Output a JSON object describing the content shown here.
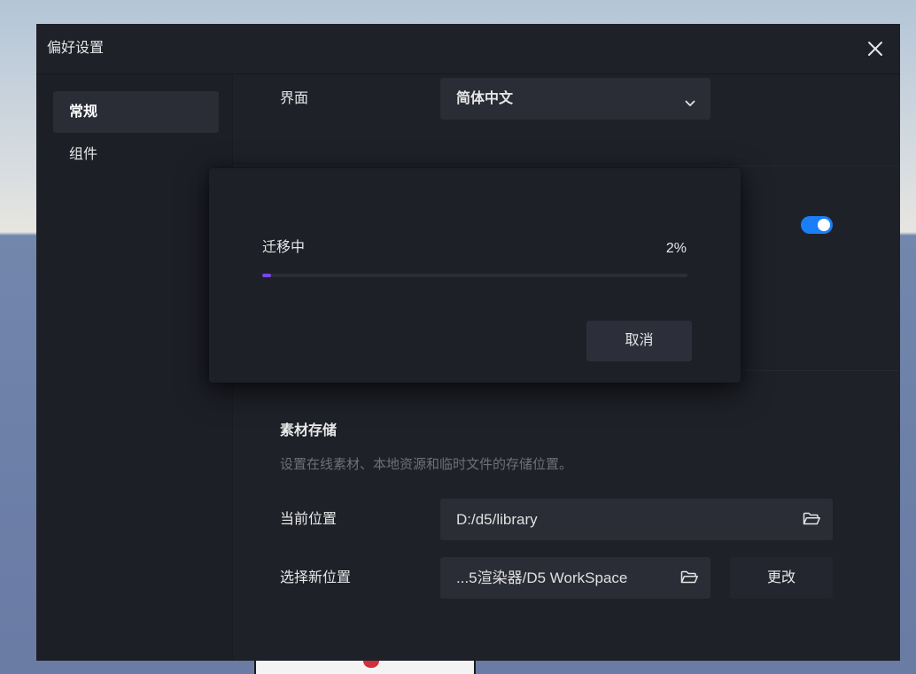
{
  "window": {
    "title": "偏好设置",
    "close_icon": "close-icon"
  },
  "sidebar": {
    "items": [
      {
        "label": "常规",
        "selected": true
      },
      {
        "label": "组件",
        "selected": false
      }
    ]
  },
  "general": {
    "interface": {
      "label": "界面",
      "value": "简体中文",
      "icon": "chevron-down-icon"
    },
    "toggle": {
      "on": true
    },
    "storage": {
      "title": "素材存储",
      "description": "设置在线素材、本地资源和临时文件的存储位置。",
      "current": {
        "label": "当前位置",
        "value": "D:/d5/library",
        "icon": "folder-icon"
      },
      "new_location": {
        "label": "选择新位置",
        "value": "...5渲染器/D5 WorkSpace",
        "icon": "folder-icon"
      },
      "change_button": "更改"
    }
  },
  "migration_dialog": {
    "title": "迁移中",
    "percent_text": "2%",
    "progress": 0.02,
    "cancel_label": "取消"
  },
  "colors": {
    "progress_fill": "#7b45f2",
    "toggle_on": "#1a7ef7",
    "dialog_bg": "#1f2129",
    "field_bg": "#2a2c36"
  }
}
